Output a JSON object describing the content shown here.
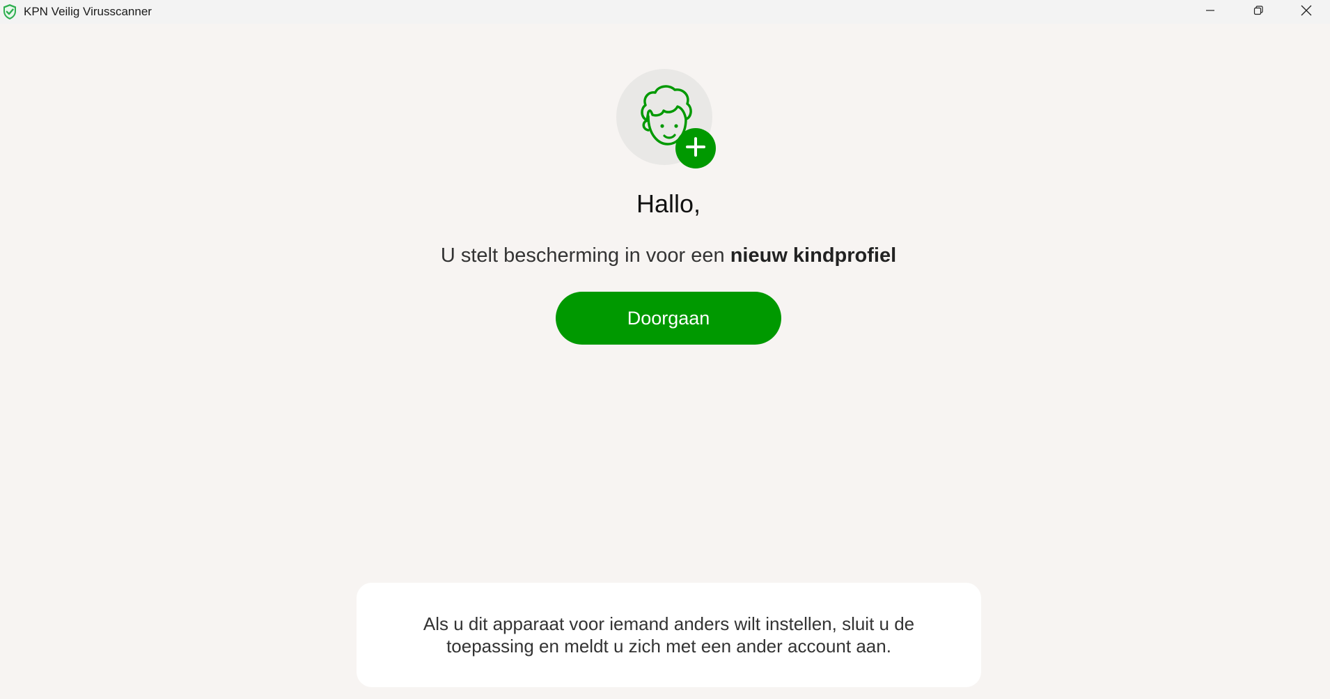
{
  "window": {
    "title": "KPN Veilig Virusscanner",
    "app_icon": "shield-check-icon",
    "controls": {
      "minimize": "minimize-icon",
      "restore": "restore-icon",
      "close": "close-icon"
    }
  },
  "main": {
    "avatar_icon": "child-profile-add-icon",
    "greeting": "Hallo,",
    "subtitle_prefix": "U stelt bescherming in voor een ",
    "subtitle_bold": "nieuw kindprofiel",
    "continue_label": "Doorgaan"
  },
  "info_card": {
    "text": "Als u dit apparaat voor iemand anders wilt instellen, sluit u de toepassing en meldt u zich met een ander account aan."
  },
  "colors": {
    "accent": "#009900",
    "background": "#f7f4f2",
    "card": "#ffffff"
  }
}
